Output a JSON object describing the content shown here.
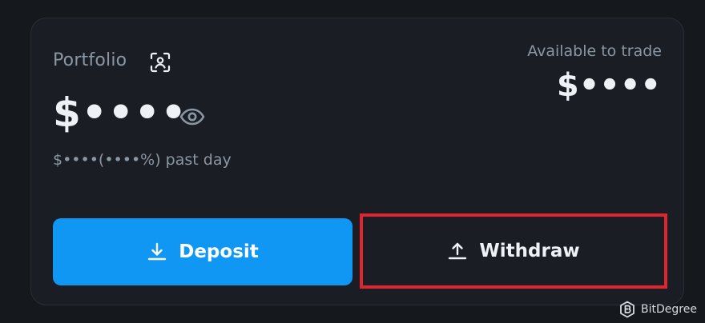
{
  "portfolio": {
    "label": "Portfolio",
    "balance": "$••••",
    "change": "$••••(••••%) past day"
  },
  "available": {
    "label": "Available to trade",
    "value": "$••••"
  },
  "actions": {
    "deposit_label": "Deposit",
    "withdraw_label": "Withdraw"
  },
  "icons": {
    "scan": "scan-face-icon",
    "visibility": "eye-icon",
    "deposit": "download-icon",
    "withdraw": "upload-icon",
    "brand": "bitdegree-logo-icon"
  },
  "colors": {
    "background": "#15181d",
    "card": "#1a1e24",
    "accent": "#1096f3",
    "highlight": "#e0252e",
    "muted_text": "#8b96a3"
  },
  "watermark": {
    "text": "BitDegree"
  }
}
